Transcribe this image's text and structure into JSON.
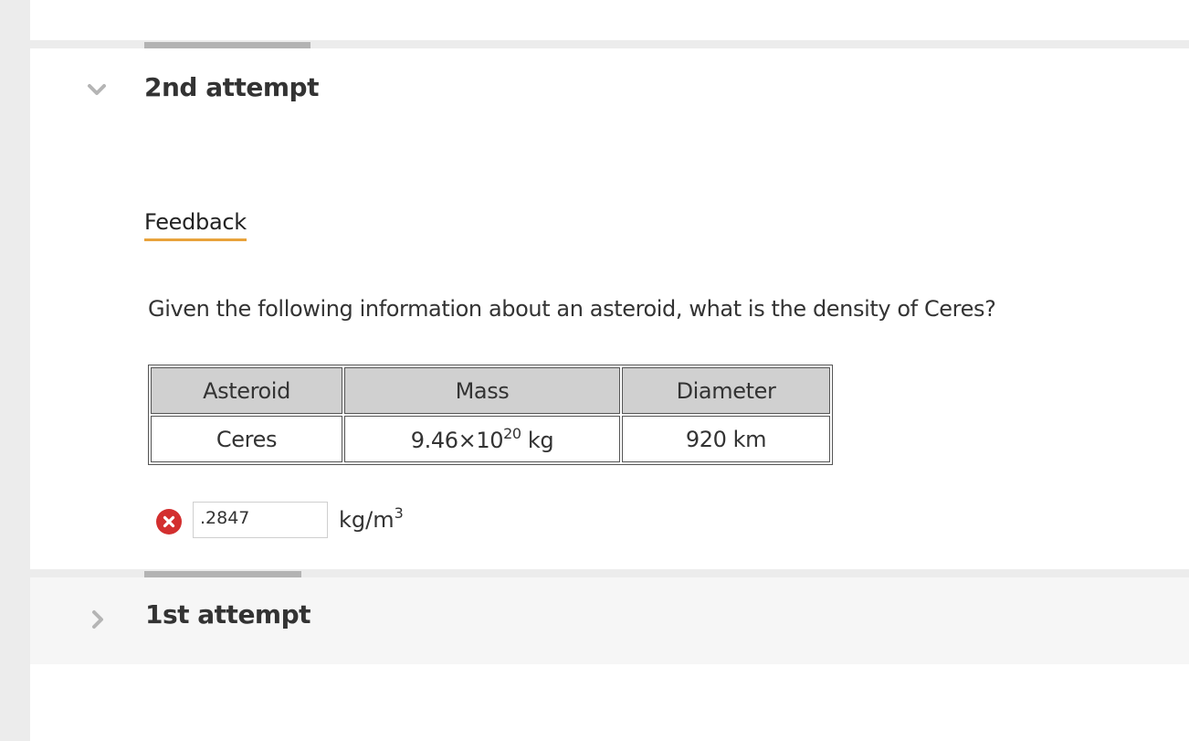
{
  "attempts": {
    "second": {
      "title": "2nd attempt",
      "expanded": true
    },
    "first": {
      "title": "1st attempt",
      "expanded": false
    }
  },
  "feedback_tab": {
    "label": "Feedback",
    "accent": "#e8a33c"
  },
  "question": {
    "text": "Given the following information about an asteroid, what is the density of Ceres?"
  },
  "table": {
    "headers": [
      "Asteroid",
      "Mass",
      "Diameter"
    ],
    "row": {
      "asteroid": "Ceres",
      "mass_base": "9.46×10",
      "mass_exp": "20",
      "mass_unit": " kg",
      "diameter": "920 km"
    }
  },
  "answer": {
    "value": ".2847",
    "status": "incorrect",
    "status_icon": "error-icon",
    "unit_base": "kg/m",
    "unit_exp": "3"
  },
  "colors": {
    "error": "#d32f2f",
    "tab_mark": "#b3b3b3",
    "rail": "#ececec"
  }
}
